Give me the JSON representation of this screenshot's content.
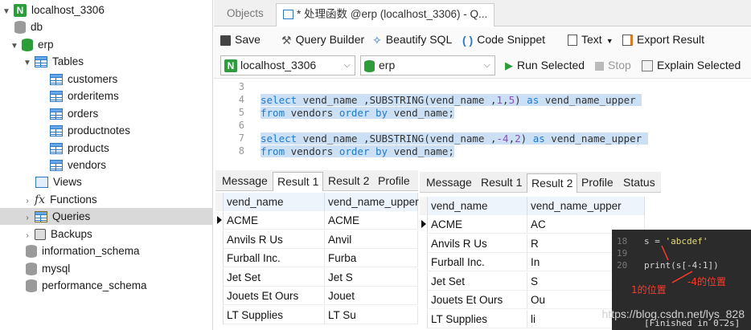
{
  "sidebar": {
    "connection": "localhost_3306",
    "db_db": "db",
    "db_erp": "erp",
    "tables_label": "Tables",
    "tables": [
      "customers",
      "orderitems",
      "orders",
      "productnotes",
      "products",
      "vendors"
    ],
    "views": "Views",
    "functions": "Functions",
    "queries": "Queries",
    "backups": "Backups",
    "others": [
      "information_schema",
      "mysql",
      "performance_schema"
    ]
  },
  "tabs": {
    "objects": "Objects",
    "query": "* 处理函数 @erp (localhost_3306) - Q..."
  },
  "toolbar": {
    "save": "Save",
    "query_builder": "Query Builder",
    "beautify": "Beautify SQL",
    "snippet": "Code Snippet",
    "text": "Text",
    "export": "Export Result"
  },
  "selectors": {
    "connection": "localhost_3306",
    "database": "erp",
    "run": "Run Selected",
    "stop": "Stop",
    "explain": "Explain Selected"
  },
  "editor": {
    "lines": [
      {
        "n": "3",
        "t": ""
      },
      {
        "n": "4"
      },
      {
        "n": "5"
      },
      {
        "n": "6",
        "t": ""
      },
      {
        "n": "7"
      },
      {
        "n": "8"
      }
    ]
  },
  "left_result": {
    "tabs": [
      "Message",
      "Result 1",
      "Result 2",
      "Profile"
    ],
    "columns": [
      "vend_name",
      "vend_name_upper"
    ],
    "rows": [
      [
        "ACME",
        "ACME"
      ],
      [
        "Anvils R Us",
        "Anvil"
      ],
      [
        "Furball Inc.",
        "Furba"
      ],
      [
        "Jet Set",
        "Jet S"
      ],
      [
        "Jouets Et Ours",
        "Jouet"
      ],
      [
        "LT Supplies",
        "LT Su"
      ]
    ]
  },
  "right_result": {
    "tabs": [
      "Message",
      "Result 1",
      "Result 2",
      "Profile",
      "Status"
    ],
    "columns": [
      "vend_name",
      "vend_name_upper"
    ],
    "rows": [
      [
        "ACME",
        "AC"
      ],
      [
        "Anvils R Us",
        "R"
      ],
      [
        "Furball Inc.",
        "In"
      ],
      [
        "Jet Set",
        " S"
      ],
      [
        "Jouets Et Ours",
        "Ou"
      ],
      [
        "LT Supplies",
        "li"
      ]
    ]
  },
  "overlay": {
    "line18": "18",
    "line19": "19",
    "line20": "20",
    "code18": "s = 'abcdef'",
    "code19": "print(s[-4:1])",
    "code20": "[Finished in 0.2s]",
    "anno1": "1的位置",
    "anno2": "-4的位置"
  },
  "watermark": "https://blog.csdn.net/lys_828",
  "colors": {
    "accent": "#2a78c8",
    "highlight": "#cce0f5",
    "keyword": "#1e7ad0",
    "annotation": "#ff3a2a"
  }
}
